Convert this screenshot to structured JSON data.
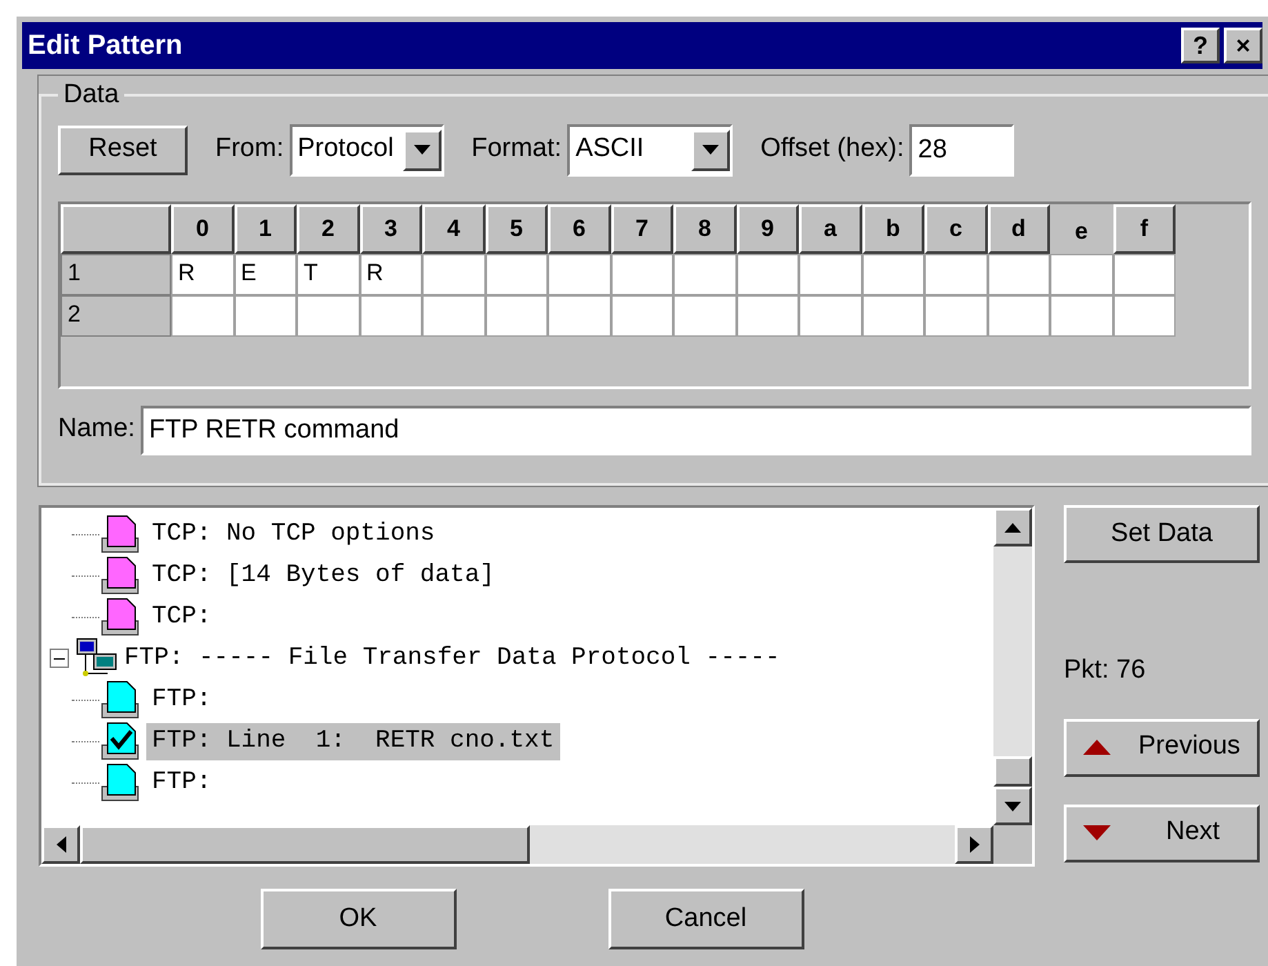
{
  "window": {
    "title": "Edit Pattern",
    "title_buttons": [
      "?",
      "×"
    ]
  },
  "data_group": {
    "label": "Data",
    "reset_button": "Reset",
    "from": {
      "label": "From:",
      "value": "Protocol"
    },
    "format": {
      "label": "Format:",
      "value": "ASCII"
    },
    "offset": {
      "label": "Offset (hex):",
      "value": "28"
    },
    "grid": {
      "columns": [
        {
          "label": "0",
          "selected": false
        },
        {
          "label": "1",
          "selected": false
        },
        {
          "label": "2",
          "selected": false
        },
        {
          "label": "3",
          "selected": false
        },
        {
          "label": "4",
          "selected": false
        },
        {
          "label": "5",
          "selected": false
        },
        {
          "label": "6",
          "selected": false
        },
        {
          "label": "7",
          "selected": false
        },
        {
          "label": "8",
          "selected": false
        },
        {
          "label": "9",
          "selected": false
        },
        {
          "label": "a",
          "selected": false
        },
        {
          "label": "b",
          "selected": false
        },
        {
          "label": "c",
          "selected": false
        },
        {
          "label": "d",
          "selected": false
        },
        {
          "label": "e",
          "selected": true
        },
        {
          "label": "f",
          "selected": false
        }
      ],
      "rows": [
        {
          "label": "1",
          "cells": [
            "R",
            "E",
            "T",
            "R"
          ]
        },
        {
          "label": "2",
          "cells": []
        }
      ]
    },
    "name": {
      "label": "Name:",
      "value": "FTP RETR command"
    }
  },
  "tree": [
    {
      "text": "TCP: No TCP options",
      "kind": "tcp",
      "selected": false
    },
    {
      "text": "TCP: [14 Bytes of data]",
      "kind": "tcp",
      "selected": false
    },
    {
      "text": "TCP:",
      "kind": "tcp",
      "selected": false
    },
    {
      "text": "FTP: ----- File Transfer Data Protocol -----",
      "kind": "protocol",
      "expanded": true,
      "selected": false,
      "children": [
        {
          "text": "FTP:",
          "kind": "ftp",
          "selected": false
        },
        {
          "text": "FTP: Line  1:  RETR cno.txt",
          "kind": "ftp",
          "selected": true
        },
        {
          "text": "FTP:",
          "kind": "ftp",
          "selected": false
        }
      ]
    }
  ],
  "side": {
    "set_data_button": "Set Data",
    "packet": "Pkt: 76",
    "previous_button": "Previous",
    "next_button": "Next"
  },
  "buttons": [
    "OK",
    "Cancel"
  ]
}
